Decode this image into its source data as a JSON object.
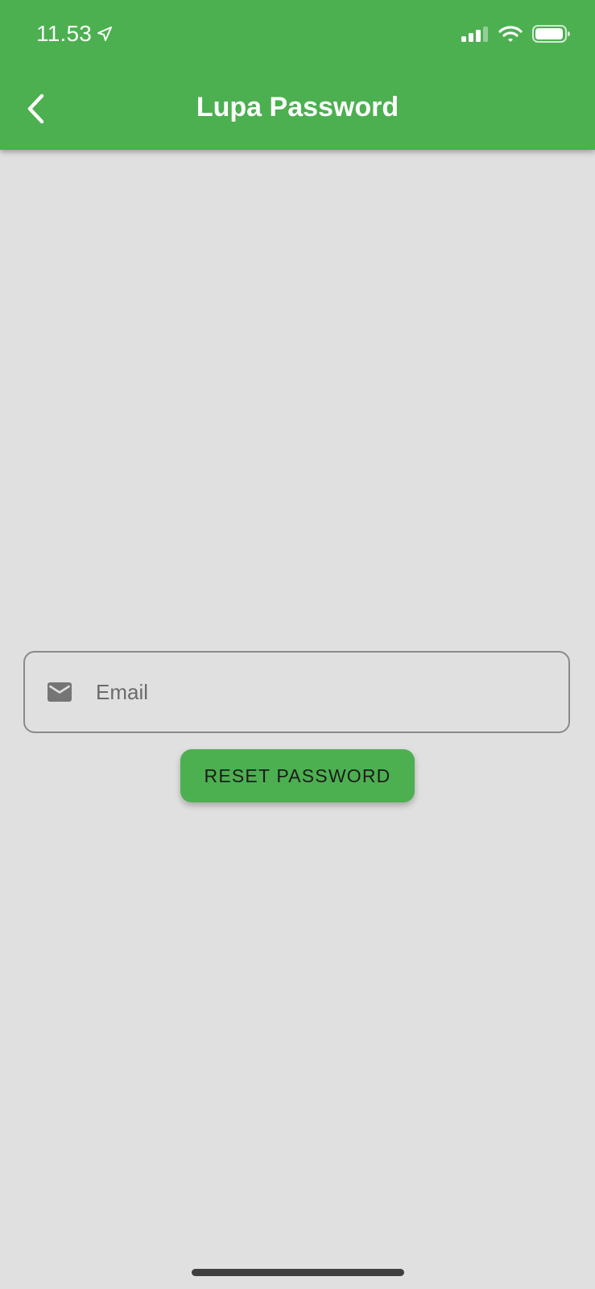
{
  "status_bar": {
    "time": "11.53",
    "location_icon": "location-arrow-icon",
    "signal_icon": "cellular-signal-icon",
    "wifi_icon": "wifi-icon",
    "battery_icon": "battery-icon"
  },
  "appbar": {
    "title": "Lupa Password",
    "back_icon": "chevron-left-icon",
    "color": "#4caf50"
  },
  "form": {
    "email": {
      "placeholder": "Email",
      "value": "",
      "icon": "mail-icon"
    },
    "reset_button": {
      "label": "RESET PASSWORD",
      "color": "#4caf50"
    }
  },
  "colors": {
    "background": "#e0e0e0",
    "accent": "#4caf50"
  }
}
